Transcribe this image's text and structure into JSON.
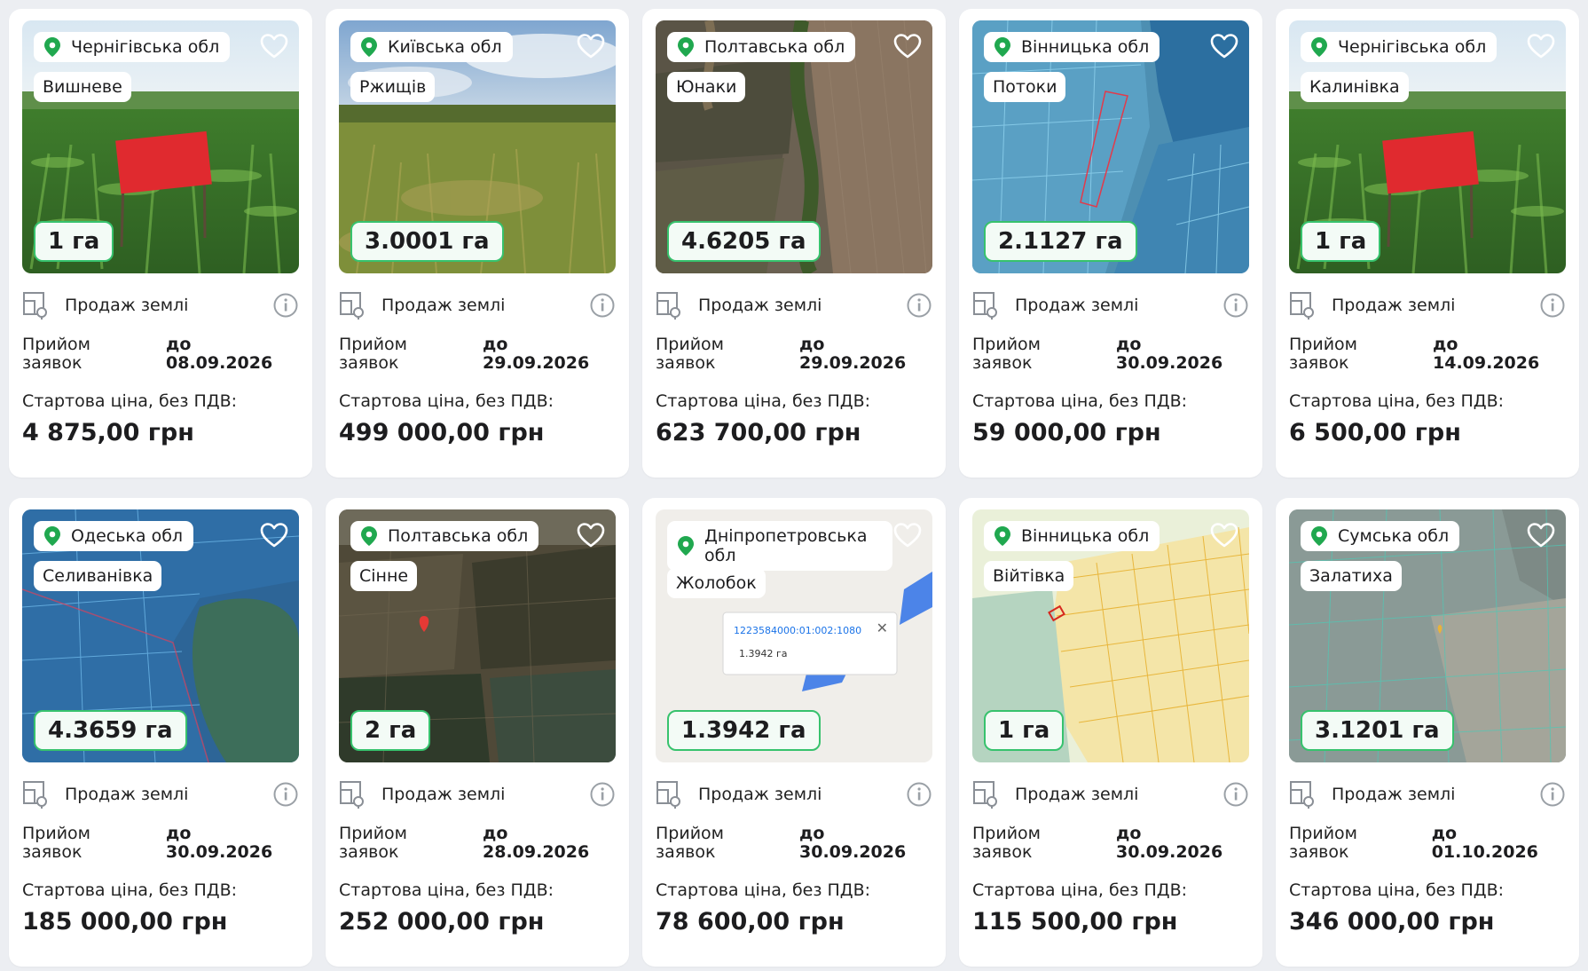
{
  "listing_type": "Продаж землі",
  "deadline_label": "Прийом заявок",
  "price_label": "Стартова ціна, без ПДВ:",
  "cards": [
    {
      "region": "Чернігівська обл",
      "village": "Вишневе",
      "area": "1 га",
      "deadline_prefix": "до",
      "deadline_date": "08.09.2026",
      "price": "4 875,00 грн",
      "image": "corn-field-sign"
    },
    {
      "region": "Київська обл",
      "village": "Ржищів",
      "area": "3.0001 га",
      "deadline_prefix": "до",
      "deadline_date": "29.09.2026",
      "price": "499 000,00 грн",
      "image": "grass-field"
    },
    {
      "region": "Полтавська обл",
      "village": "Юнаки",
      "area": "4.6205 га",
      "deadline_prefix": "до",
      "deadline_date": "29.09.2026",
      "price": "623 700,00 грн",
      "image": "satellite-fields"
    },
    {
      "region": "Вінницька обл",
      "village": "Потоки",
      "area": "2.1127 га",
      "deadline_prefix": "до",
      "deadline_date": "30.09.2026",
      "price": "59 000,00 грн",
      "image": "cadastral-map-blue"
    },
    {
      "region": "Чернігівська обл",
      "village": "Калинівка",
      "area": "1 га",
      "deadline_prefix": "до",
      "deadline_date": "14.09.2026",
      "price": "6 500,00 грн",
      "image": "corn-field-sign"
    },
    {
      "region": "Одеська обл",
      "village": "Селиванівка",
      "area": "4.3659 га",
      "deadline_prefix": "до",
      "deadline_date": "30.09.2026",
      "price": "185 000,00 грн",
      "image": "cadastral-map-forest"
    },
    {
      "region": "Полтавська обл",
      "village": "Сінне",
      "area": "2 га",
      "deadline_prefix": "до",
      "deadline_date": "28.09.2026",
      "price": "252 000,00 грн",
      "image": "satellite-map-pin"
    },
    {
      "region": "Дніпропетровська обл",
      "village": "Жолобок",
      "area": "1.3942 га",
      "deadline_prefix": "до",
      "deadline_date": "30.09.2026",
      "price": "78 600,00 грн",
      "image": "cadastral-popup",
      "popup_id": "1223584000:01:002:1080",
      "popup_area": "1.3942 га"
    },
    {
      "region": "Вінницька обл",
      "village": "Війтівка",
      "area": "1 га",
      "deadline_prefix": "до",
      "deadline_date": "30.09.2026",
      "price": "115 500,00 грн",
      "image": "cadastral-map-yellow"
    },
    {
      "region": "Сумська обл",
      "village": "Залатиха",
      "area": "3.1201 га",
      "deadline_prefix": "до",
      "deadline_date": "01.10.2026",
      "price": "346 000,00 грн",
      "image": "cadastral-map-grey",
      "deadline_inline": true
    }
  ],
  "colors": {
    "accent_green": "#37c26d",
    "pin_green": "#20a84f",
    "background": "#eceef2"
  }
}
